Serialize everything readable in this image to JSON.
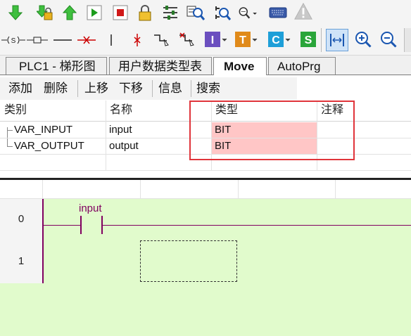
{
  "toolbar_row1": {
    "icons": [
      "download-arrow-icon",
      "lock-arrow-icon",
      "upload-arrow-icon",
      "run-icon",
      "stop-icon",
      "lock-icon",
      "settings-sliders-icon",
      "monitor-zoom-icon",
      "refresh-zoom-icon",
      "find-zoom-icon",
      "keyboard-icon",
      "warning-icon"
    ]
  },
  "toolbar_row2": {
    "icons": [
      "coil-set-icon",
      "contact-icon",
      "line-icon",
      "delete-line-icon",
      "vertical-line-icon",
      "delete-vertical-icon",
      "branch-icon",
      "delete-branch-icon",
      "I-block-icon",
      "T-block-icon",
      "C-block-icon",
      "S-block-icon",
      "fit-width-icon",
      "zoom-in-icon",
      "zoom-out-icon"
    ],
    "block_letters": {
      "i": "I",
      "t": "T",
      "c": "C",
      "s": "S"
    },
    "block_colors": {
      "i": "#6b4fbf",
      "t": "#e08a1a",
      "c": "#1e9fd8",
      "s": "#2aa53a"
    }
  },
  "tabs": [
    {
      "label": "PLC1 - 梯形图",
      "active": false
    },
    {
      "label": "用户数据类型表",
      "active": false
    },
    {
      "label": "Move",
      "active": true
    },
    {
      "label": "AutoPrg",
      "active": false
    }
  ],
  "actions": [
    "添加",
    "删除",
    "上移",
    "下移",
    "信息",
    "搜索"
  ],
  "var_table": {
    "headers": [
      "类别",
      "名称",
      "类型",
      "注释"
    ],
    "rows": [
      {
        "category": "VAR_INPUT",
        "name": "input",
        "type": "BIT",
        "comment": ""
      },
      {
        "category": "VAR_OUTPUT",
        "name": "output",
        "type": "BIT",
        "comment": ""
      }
    ],
    "highlight_color": "#ffc6c6",
    "box_color": "#e0343a"
  },
  "ladder": {
    "rows": [
      "0",
      "1"
    ],
    "contact_label": "input",
    "wire_color": "#800060",
    "background": "#e1fbcc"
  }
}
